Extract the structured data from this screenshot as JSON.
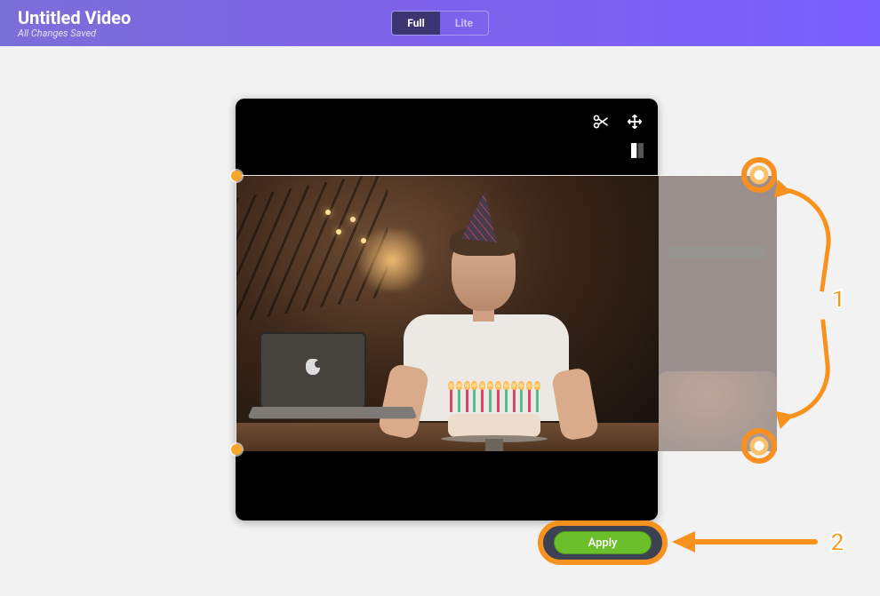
{
  "header": {
    "title": "Untitled Video",
    "subtitle": "All Changes Saved",
    "mode": {
      "full": "Full",
      "lite": "Lite",
      "active": "full"
    }
  },
  "tools": {
    "cut": "cut-icon",
    "move": "move-icon",
    "flip": "flip-icon"
  },
  "apply": {
    "label": "Apply"
  },
  "annotations": {
    "step1": "1",
    "step2": "2"
  }
}
